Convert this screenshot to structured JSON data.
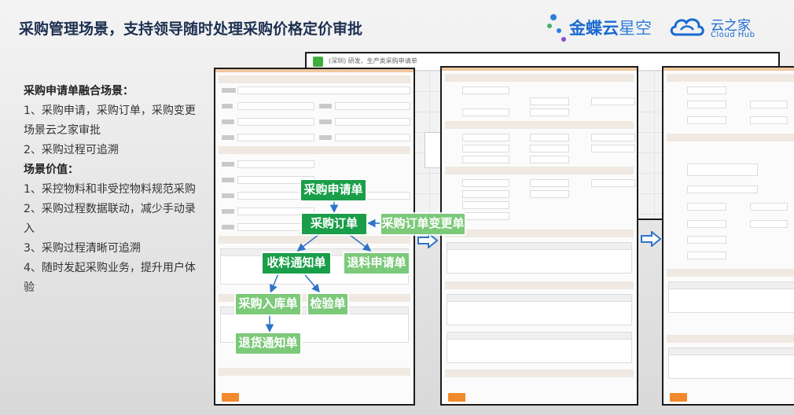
{
  "slide": {
    "title": "采购管理场景，支持领导随时处理采购价格定价审批"
  },
  "brand": {
    "kingdee": "金蝶云",
    "kingdee_suffix": "星空",
    "cloudhub_zh": "云之家",
    "cloudhub_en": "Cloud Hub",
    "colors": {
      "primary": "#1a6ad0",
      "dot_blue": "#2e7fd8",
      "dot_purple": "#8a4fd0",
      "dot_green": "#3fb36a"
    }
  },
  "left_panel": {
    "lines": [
      {
        "text": "采购申请单融合场景：",
        "heading": true
      },
      {
        "text": "1、采购申请，采购订单，采购变更场景云之家审批",
        "heading": false
      },
      {
        "text": "2、采购过程可追溯",
        "heading": false
      },
      {
        "text": "场景价值：",
        "heading": true
      },
      {
        "text": "1、采控物料和非受控物料规范采购",
        "heading": false
      },
      {
        "text": "2、采购过程数据联动，减少手动录入",
        "heading": false
      },
      {
        "text": "3、采购过程清晰可追溯",
        "heading": false
      },
      {
        "text": "4、随时发起采购业务，提升用户体验",
        "heading": false
      }
    ]
  },
  "back_window": {
    "title": "(深圳) 研发、生产类采购申请单"
  },
  "flow": {
    "nodes": {
      "purchase_request": "采购申请单",
      "purchase_order": "采购订单",
      "order_change": "采购订单变更单",
      "receipt_notice": "收料通知单",
      "return_request": "退料申请单",
      "warehouse_in": "采购入库单",
      "inspection": "检验单",
      "return_notice": "退货通知单"
    },
    "colors": {
      "dark": "#1b9e4a",
      "light": "#7cc97a"
    }
  }
}
